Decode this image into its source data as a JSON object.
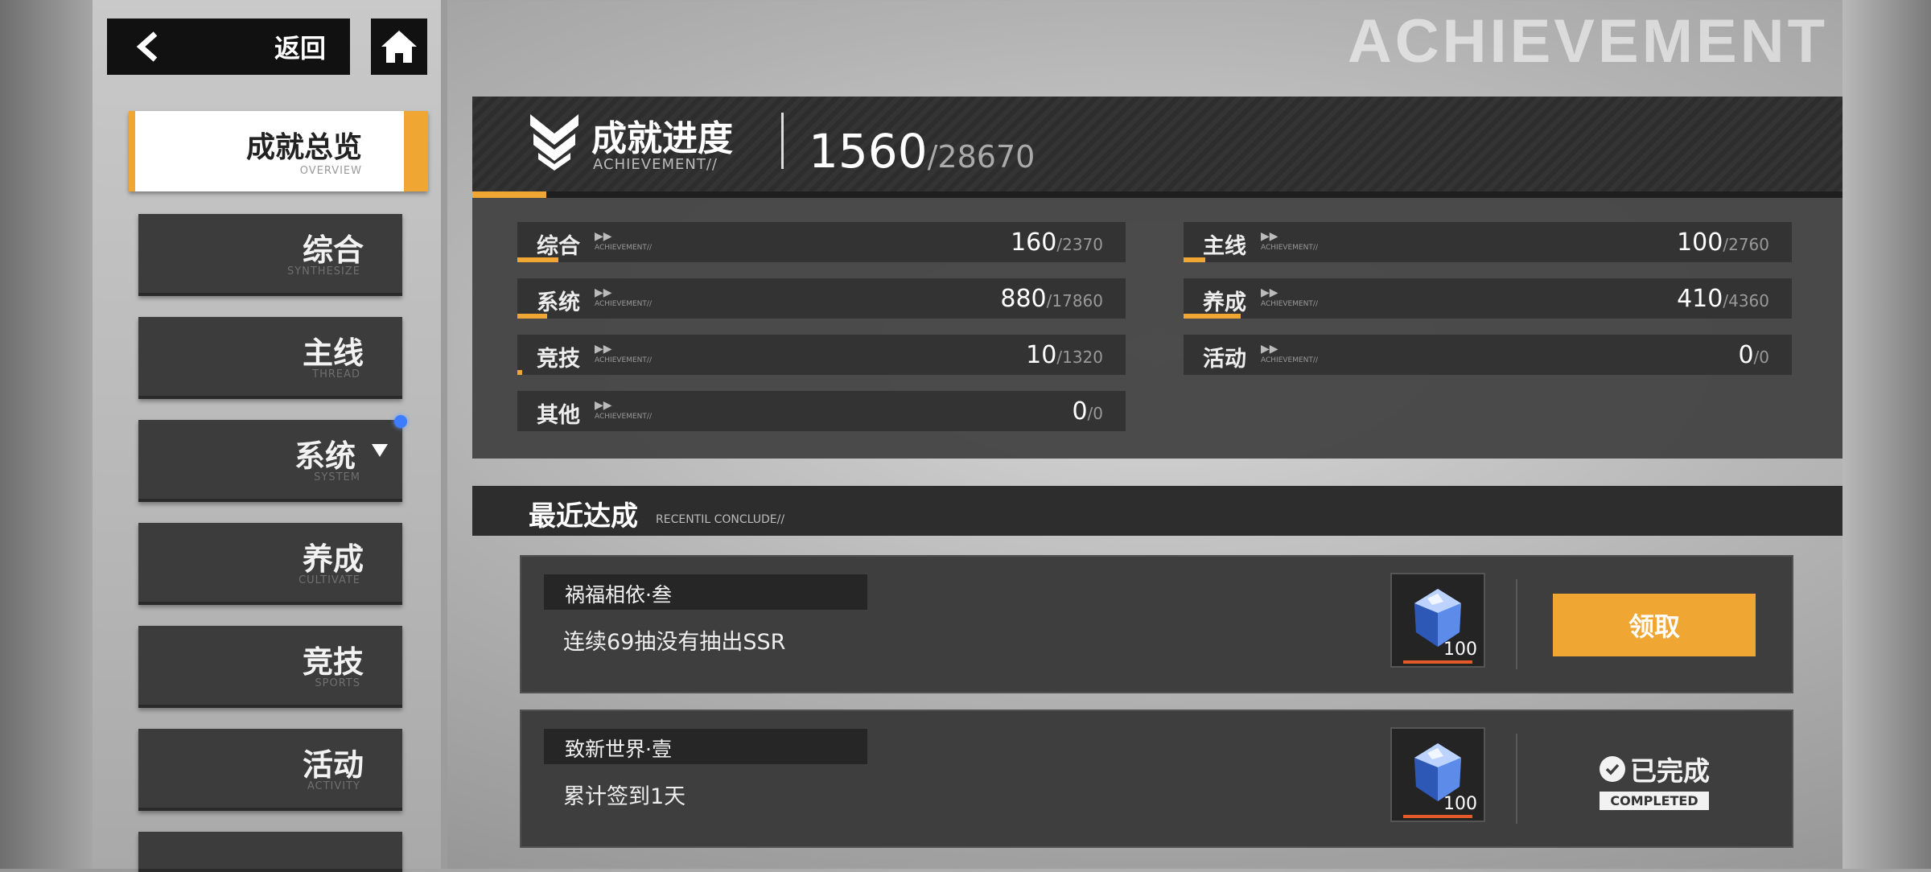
{
  "header": {
    "back_label": "返回",
    "back_icon": "chevron-left-icon",
    "home_icon": "home-icon",
    "watermark": "ACHIEVEMENT"
  },
  "sidebar": {
    "items": [
      {
        "zh": "成就总览",
        "en": "OVERVIEW",
        "active": true
      },
      {
        "zh": "综合",
        "en": "SYNTHESIZE"
      },
      {
        "zh": "主线",
        "en": "THREAD"
      },
      {
        "zh": "系统",
        "en": "SYSTEM",
        "has_dropdown": true,
        "notification": true
      },
      {
        "zh": "养成",
        "en": "CULTIVATE"
      },
      {
        "zh": "竞技",
        "en": "SPORTS"
      },
      {
        "zh": "活动",
        "en": "ACTIVITY"
      }
    ],
    "notification_color": "#3d7bff"
  },
  "progress": {
    "title": "成就进度",
    "subtitle": "ACHIEVEMENT//",
    "score": "1560",
    "total": "/28670",
    "accent_color": "#f0a633",
    "categories": [
      {
        "zh": "综合",
        "en": "ACHIEVEMENT//",
        "value": "160",
        "total": "/2370",
        "fraction": 0.0675
      },
      {
        "zh": "主线",
        "en": "ACHIEVEMENT//",
        "value": "100",
        "total": "/2760",
        "fraction": 0.036
      },
      {
        "zh": "系统",
        "en": "ACHIEVEMENT//",
        "value": "880",
        "total": "/17860",
        "fraction": 0.049
      },
      {
        "zh": "养成",
        "en": "ACHIEVEMENT//",
        "value": "410",
        "total": "/4360",
        "fraction": 0.094
      },
      {
        "zh": "竞技",
        "en": "ACHIEVEMENT//",
        "value": "10",
        "total": "/1320",
        "fraction": 0.0076
      },
      {
        "zh": "活动",
        "en": "ACHIEVEMENT//",
        "value": "0",
        "total": "/0",
        "fraction": 0
      },
      {
        "zh": "其他",
        "en": "ACHIEVEMENT//",
        "value": "0",
        "total": "/0",
        "fraction": 0
      }
    ]
  },
  "recent": {
    "title": "最近达成",
    "subtitle": "RECENTIL CONCLUDE//",
    "items": [
      {
        "name": "祸福相依·叁",
        "desc": "连续69抽没有抽出SSR",
        "reward_icon": "crystal-icon",
        "reward_amount": "100",
        "action": "领取",
        "status": "claimable"
      },
      {
        "name": "致新世界·壹",
        "desc": "累计签到1天",
        "reward_icon": "crystal-icon",
        "reward_amount": "100",
        "status": "completed",
        "status_zh": "已完成",
        "status_en": "COMPLETED"
      }
    ]
  }
}
